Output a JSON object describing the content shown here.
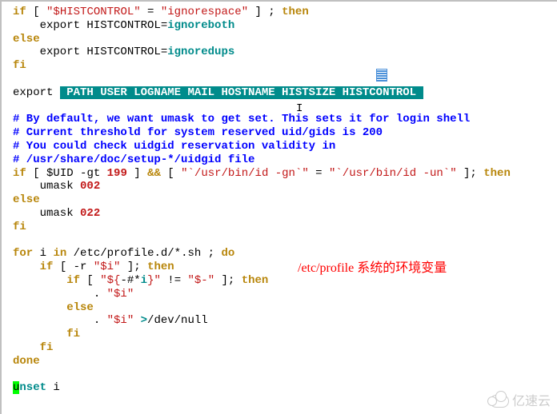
{
  "code": {
    "l1_kw1": "if",
    "l1_op1": " [ ",
    "l1_str1": "\"$HISTCONTROL\"",
    "l1_op2": " = ",
    "l1_str2": "\"ignorespace\"",
    "l1_op3": " ] ; ",
    "l1_kw2": "then",
    "l2_txt": "    export HISTCONTROL=",
    "l2_id": "ignoreboth",
    "l3_kw": "else",
    "l4_txt": "    export HISTCONTROL=",
    "l4_id": "ignoredups",
    "l5_kw": "fi",
    "l6": "",
    "l7_txt": "export ",
    "l7_hl": " PATH USER LOGNAME MAIL HOSTNAME HISTSIZE HISTCONTROL ",
    "l8": "",
    "l9_cmt": "# By default, we want umask to get set. This sets it for login shell",
    "l10_cmt": "# Current threshold for system reserved uid/gids is 200",
    "l11_cmt": "# You could check uidgid reservation validity in",
    "l12_cmt": "# /usr/share/doc/setup-*/uidgid file",
    "l13_kw1": "if",
    "l13_op1": " [ ",
    "l13_var": "$UID",
    "l13_op2": " -gt ",
    "l13_num": "199",
    "l13_op3": " ] ",
    "l13_amp": "&&",
    "l13_op4": " [ ",
    "l13_str1": "\"`/usr/bin/id -gn`\"",
    "l13_op5": " = ",
    "l13_str2": "\"`/usr/bin/id -un`\"",
    "l13_op6": " ]; ",
    "l13_kw2": "then",
    "l14_txt": "    umask ",
    "l14_num": "002",
    "l15_kw": "else",
    "l16_txt": "    umask ",
    "l16_num": "022",
    "l17_kw": "fi",
    "l18": "",
    "l19_kw1": "for",
    "l19_txt1": " i ",
    "l19_kw2": "in",
    "l19_txt2": " /etc/profile.d/*.sh ; ",
    "l19_kw3": "do",
    "l20_kw1": "    if",
    "l20_op1": " [ -r ",
    "l20_str": "\"$i\"",
    "l20_op2": " ]; ",
    "l20_kw2": "then",
    "l21_kw1": "        if",
    "l21_op1": " [ ",
    "l21_str1a": "\"${",
    "l21_str1b": "-#*",
    "l21_str1c": "i",
    "l21_str1d": "}\"",
    "l21_op2": " != ",
    "l21_str2": "\"$-\"",
    "l21_op3": " ]; ",
    "l21_kw2": "then",
    "l22_txt": "            . ",
    "l22_str": "\"$i\"",
    "l23_kw": "        else",
    "l24_txt1": "            . ",
    "l24_str": "\"$i\"",
    "l24_op": " >",
    "l24_txt2": "/dev/null",
    "l25_kw": "        fi",
    "l26_kw": "    fi",
    "l27_kw": "done",
    "l28": "",
    "l29_u": "u",
    "l29_rest": "nset",
    "l29_i": " i"
  },
  "annotation": "/etc/profile 系统的环境变量",
  "watermark": "亿速云",
  "ibeam": "I"
}
